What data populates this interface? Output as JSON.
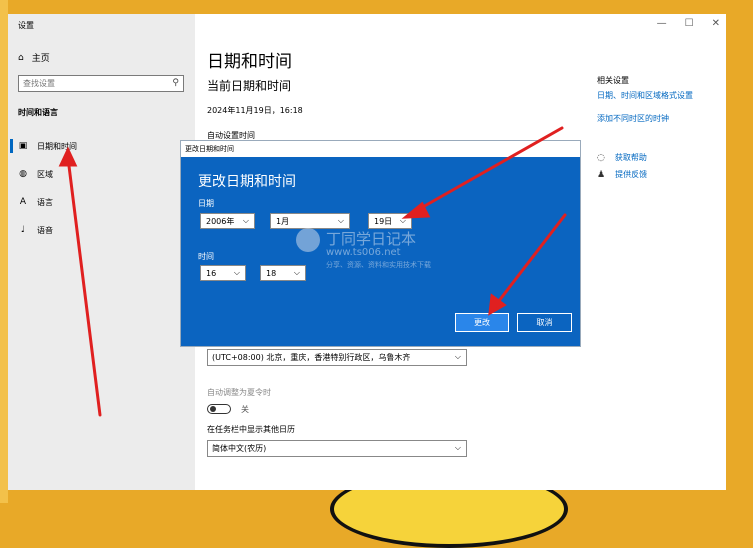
{
  "window": {
    "title": "设置"
  },
  "sidebar": {
    "home": "主页",
    "search_placeholder": "查找设置",
    "section": "时间和语言",
    "items": [
      {
        "label": "日期和时间",
        "icon": "calendar-clock-icon"
      },
      {
        "label": "区域",
        "icon": "globe-icon"
      },
      {
        "label": "语言",
        "icon": "language-icon"
      },
      {
        "label": "语音",
        "icon": "microphone-icon"
      }
    ]
  },
  "main": {
    "title": "日期和时间",
    "subtitle": "当前日期和时间",
    "current_datetime": "2024年11月19日，16:18",
    "auto_set_label": "自动设置时间",
    "timezone_value": "(UTC+08:00) 北京，重庆，香港特别行政区，乌鲁木齐",
    "dst_label": "自动调整为夏令时",
    "dst_toggle_state": "关",
    "calendar_label": "在任务栏中显示其他日历",
    "calendar_value": "简体中文(农历)"
  },
  "related": {
    "title": "相关设置",
    "links": [
      "日期、时间和区域格式设置",
      "添加不同时区的时钟"
    ],
    "help": [
      "获取帮助",
      "提供反馈"
    ]
  },
  "dialog": {
    "window_title": "更改日期和时间",
    "heading": "更改日期和时间",
    "date_label": "日期",
    "year": "2006年",
    "month": "1月",
    "day": "19日",
    "time_label": "时间",
    "hour": "16",
    "minute": "18",
    "change_button": "更改",
    "cancel_button": "取消"
  },
  "watermark": {
    "title": "丁同学日记本",
    "url": "www.ts006.net",
    "subtitle": "分享、资源、资料和实用技术下载"
  },
  "colors": {
    "accent": "#0067c0",
    "dialog_bg": "#0b64c0",
    "arrow": "#e02020"
  }
}
